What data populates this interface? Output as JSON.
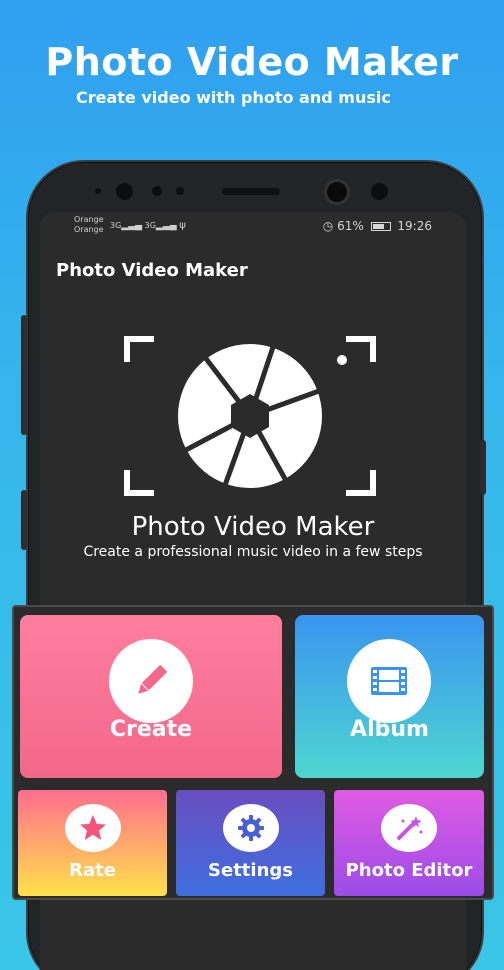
{
  "promo": {
    "title": "Photo Video Maker",
    "subtitle": "Create video with photo and music"
  },
  "status_bar": {
    "carrier_1": "Orange",
    "carrier_2": "Orange",
    "signal_1": "3G",
    "signal_2": "3G",
    "battery": "61%",
    "time": "19:26",
    "icons": [
      "alarm-icon",
      "battery-icon",
      "usb-icon",
      "signal-icon"
    ]
  },
  "app": {
    "title": "Photo Video Maker",
    "logo_title": "Photo Video Maker",
    "logo_subtitle": "Create a professional music video in a few steps"
  },
  "menu": {
    "create": {
      "label": "Create",
      "icon": "pencil-icon",
      "color": "#f76f91"
    },
    "album": {
      "label": "Album",
      "icon": "film-icon",
      "color": "#3fb2e0"
    },
    "rate": {
      "label": "Rate",
      "icon": "star-icon",
      "color": "#ff8a7a"
    },
    "settings": {
      "label": "Settings",
      "icon": "gear-icon",
      "color": "#5460d0"
    },
    "photo_editor": {
      "label": "Photo Editor",
      "icon": "magic-wand-icon",
      "color": "#c754e5"
    }
  }
}
